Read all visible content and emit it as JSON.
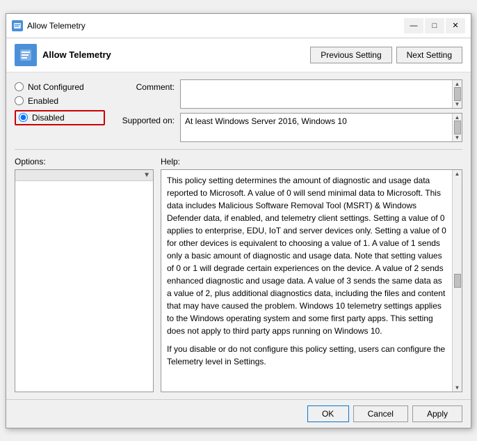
{
  "window": {
    "title": "Allow Telemetry",
    "header_title": "Allow Telemetry"
  },
  "buttons": {
    "previous": "Previous Setting",
    "next": "Next Setting",
    "ok": "OK",
    "cancel": "Cancel",
    "apply": "Apply"
  },
  "title_controls": {
    "minimize": "—",
    "maximize": "□",
    "close": "✕"
  },
  "radio": {
    "not_configured": "Not Configured",
    "enabled": "Enabled",
    "disabled": "Disabled"
  },
  "labels": {
    "comment": "Comment:",
    "supported_on": "Supported on:",
    "options": "Options:",
    "help": "Help:"
  },
  "supported_text": "At least Windows Server 2016, Windows 10",
  "help_text_1": "This policy setting determines the amount of diagnostic and usage data reported to Microsoft. A value of 0 will send minimal data to Microsoft. This data includes Malicious Software Removal Tool (MSRT) & Windows Defender data, if enabled, and telemetry client settings. Setting a value of 0 applies to enterprise, EDU, IoT and server devices only. Setting a value of 0 for other devices is equivalent to choosing a value of 1. A value of 1 sends only a basic amount of diagnostic and usage data. Note that setting values of 0 or 1 will degrade certain experiences on the device. A value of 2 sends enhanced diagnostic and usage data. A value of 3 sends the same data as a value of 2, plus additional diagnostics data, including the files and content that may have caused the problem. Windows 10 telemetry settings applies to the Windows operating system and some first party apps. This setting does not apply to third party apps running on Windows 10.",
  "help_text_2": "If you disable or do not configure this policy setting, users can configure the Telemetry level in Settings."
}
